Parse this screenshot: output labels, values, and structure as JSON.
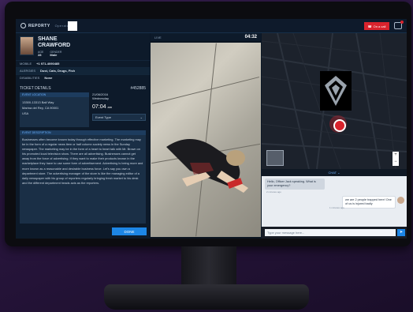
{
  "app": {
    "brand": "REPORTY",
    "brand_sub": "Operator",
    "call_button": "On a call"
  },
  "caller": {
    "name_line1": "SHANE",
    "name_line2": "CRAWFORD",
    "age_label": "AGE",
    "age": "28",
    "gender_label": "GENDER",
    "gender": "Male",
    "mobile_label": "MOBILE",
    "mobile": "+1 971-4090485",
    "allergies_label": "ALERGIES",
    "allergies": "Dust, Cats, Drugs, Fish",
    "disabilities_label": "DISABILITIES",
    "disabilities": "None"
  },
  "ticket": {
    "title": "TICKET DETAILS",
    "number": "#452885",
    "location_title": "EVENT LOCATION",
    "address1": "13300-13313 Bali Way",
    "address2": "Marina del Rey, CA 90001",
    "country": "USA",
    "date": "21/06/2016",
    "weekday": "Wednesday",
    "time": "07:04",
    "time_suffix": "am",
    "event_type": "Event Type",
    "desc_title": "EVENT DESCRIPTION",
    "description": "Businesses often become known today through effective marketing. The marketing may be in the form of a regular news item or half column society news in the Sunday newspaper. The marketing may be in the form of a heart to heart talk with Mr. Brown on his promoted local television show. There are all advertising. Businesses cannot get away from the force of advertising. If they want to make their products known in the marketplace they have to use some form of advertisement. Advertising is being more and more known as a reasonable and desirable business force. Let's say you own a department store. The advertising manager of the store is like the managing editor of a daily newspaper with his group of reporters regularly bringing fresh market to his desk and the different department heads acts as the reporters.",
    "done": "DONE"
  },
  "video": {
    "label": "LIVE",
    "timer": "04:32"
  },
  "chat": {
    "header": "CHAT",
    "msg1": "Hello, Officer Jack speaking. What is your emergency?",
    "msg1_time": "2 minutes ago",
    "msg2": "we are 2 people trapped here! One of us is injured badly",
    "msg2_time": "1 minutes ago",
    "input_placeholder": "Type your message here...",
    "send": "➤"
  },
  "colors": {
    "accent": "#1d86e5",
    "alert": "#d9232d"
  }
}
